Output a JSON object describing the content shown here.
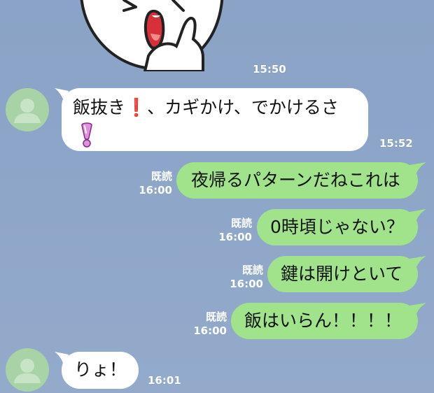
{
  "messages": [
    {
      "side": "in",
      "lines": [
        "飯抜き",
        "、カギかけ、でかけるさ"
      ],
      "emoji1": "❗",
      "time": "15:52"
    },
    {
      "side": "out",
      "text": "夜帰るパターンだねこれは",
      "read": "既読",
      "time": "16:00"
    },
    {
      "side": "out",
      "text": "0時頃じゃない？",
      "read": "既読",
      "time": "16:00"
    },
    {
      "side": "out",
      "text": "鍵は開けといて",
      "read": "既読",
      "time": "16:00"
    },
    {
      "side": "out",
      "text": "飯はいらん！！！！",
      "read": "既読",
      "time": "16:00"
    },
    {
      "side": "in",
      "text": "りょ！",
      "time": "16:01"
    }
  ],
  "sticker_time": "15:50",
  "icons": {
    "sticker": "cony-sticker-icon",
    "avatar": "default-user-avatar-icon",
    "red_exclamation": "red-exclamation-icon",
    "pink_exclamation": "pink-exclamation-icon"
  },
  "colors": {
    "background": "#8da5c8",
    "incoming_bubble": "#ffffff",
    "outgoing_bubble": "#a1e38a",
    "avatar": "#a7d3a6"
  }
}
